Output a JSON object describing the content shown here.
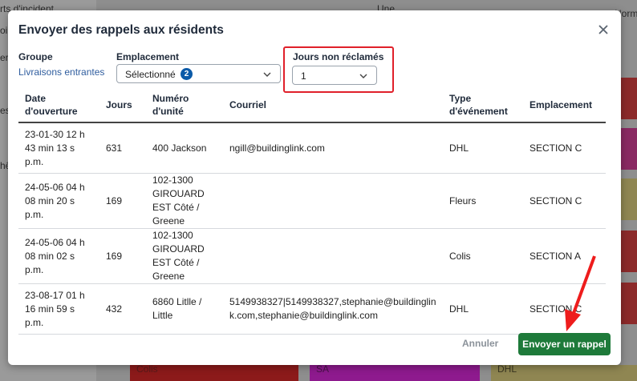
{
  "background": {
    "items": [
      "rts d'incident",
      "oi",
      "er",
      "es",
      "hê",
      "Une",
      "Norm",
      "Colis",
      "SA",
      "DHL"
    ]
  },
  "modal": {
    "title": "Envoyer des rappels aux résidents",
    "group_label": "Groupe",
    "group_value": "Livraisons entrantes",
    "location_label": "Emplacement",
    "location_value": "Sélectionné",
    "location_badge": "2",
    "days_label": "Jours non réclamés",
    "days_value": "1",
    "columns": [
      "Date d'ouverture",
      "Jours",
      "Numéro d'unité",
      "Courriel",
      "Type d'événement",
      "Emplacement"
    ],
    "rows": [
      {
        "date": "23-01-30 12 h 43 min 13 s p.m.",
        "days": "631",
        "unit": "400 Jackson",
        "email": "ngill@buildinglink.com",
        "type": "DHL",
        "location": "SECTION C"
      },
      {
        "date": "24-05-06 04 h 08 min 20 s p.m.",
        "days": "169",
        "unit": "102-1300 GIROUARD EST Côté / Greene",
        "email": "",
        "type": "Fleurs",
        "location": "SECTION C"
      },
      {
        "date": "24-05-06 04 h 08 min 02 s p.m.",
        "days": "169",
        "unit": "102-1300 GIROUARD EST Côté / Greene",
        "email": "",
        "type": "Colis",
        "location": "SECTION A"
      },
      {
        "date": "23-08-17 01 h 16 min 59 s p.m.",
        "days": "432",
        "unit": "6860 Litlle / Little",
        "email": "5149938327|5149938327,stephanie@buildinglink.com,stephanie@buildinglink.com",
        "type": "DHL",
        "location": "SECTION C"
      }
    ],
    "cancel_label": "Annuler",
    "send_label": "Envoyer un rappel"
  },
  "colors": {
    "accent": "#1e7a3a",
    "highlight": "#e0202a",
    "badge": "#0b5aa8"
  }
}
